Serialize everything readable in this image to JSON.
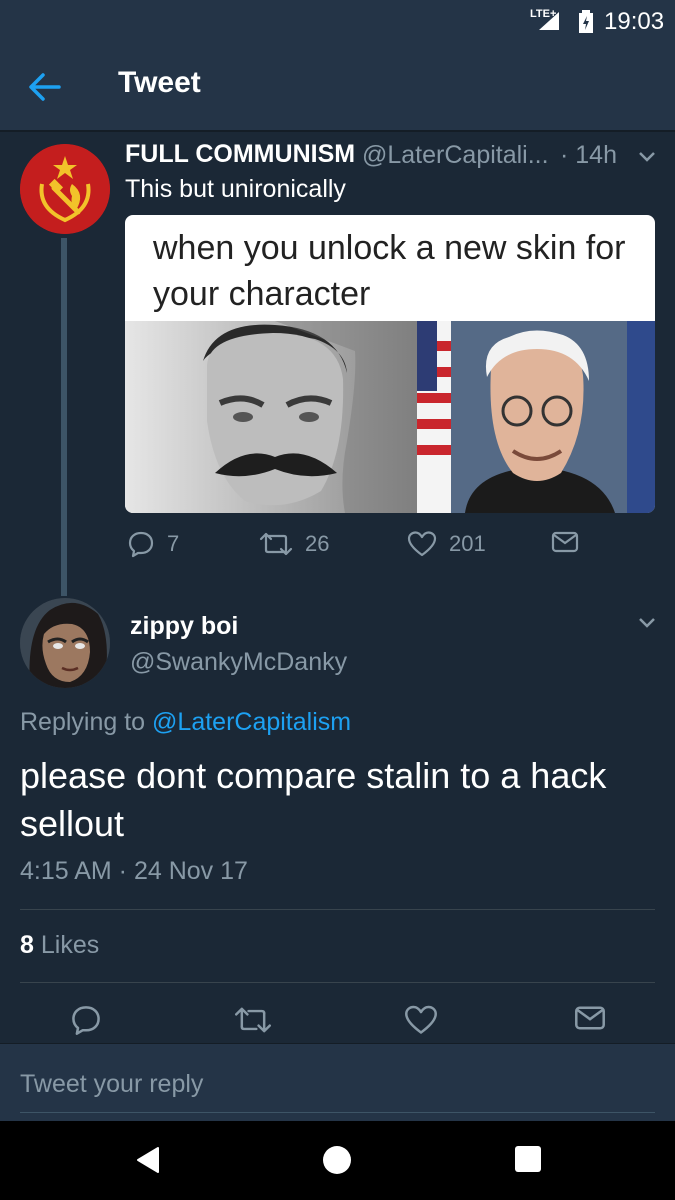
{
  "status_bar": {
    "network": "LTE+",
    "time": "19:03"
  },
  "app_bar": {
    "title": "Tweet",
    "back_icon": "arrow-left-icon"
  },
  "parent_tweet": {
    "display_name": "FULL COMMUNISM",
    "handle": "@LaterCapitali...",
    "time": "· 14h",
    "text": "This but unironically",
    "media_caption": "when you unlock a new skin for your character",
    "reply_count": "7",
    "retweet_count": "26",
    "like_count": "201"
  },
  "reply_tweet": {
    "display_name": "zippy boi",
    "handle": "@SwankyMcDanky",
    "replying_prefix": "Replying to",
    "replying_to": "@LaterCapitalism",
    "text": "please dont compare stalin to a hack sellout",
    "timestamp": "4:15 AM · 24 Nov 17",
    "likes_count": "8",
    "likes_label": "Likes"
  },
  "composer": {
    "placeholder": "Tweet your reply"
  },
  "colors": {
    "background": "#1b2836",
    "bar": "#243447",
    "accent": "#1da1f2",
    "muted": "#8899a6"
  }
}
